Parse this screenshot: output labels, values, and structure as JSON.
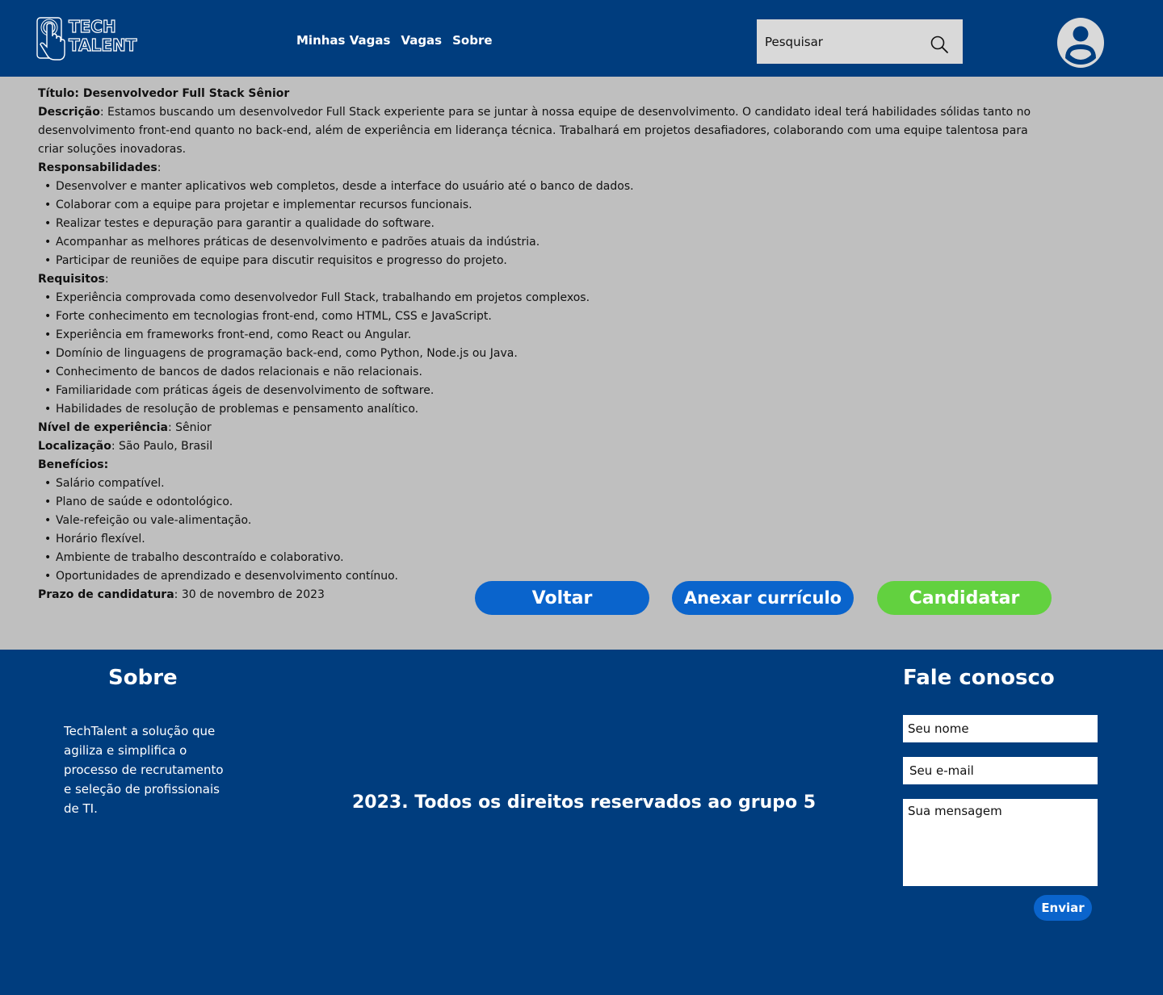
{
  "header": {
    "logo_text_line1": "TECH",
    "logo_text_line2": "TALENT",
    "nav": [
      {
        "label": "Minhas Vagas"
      },
      {
        "label": "Vagas"
      },
      {
        "label": "Sobre"
      }
    ],
    "search": {
      "placeholder": "Pesquisar",
      "icon": "search-icon"
    },
    "avatar_icon": "user-icon"
  },
  "job": {
    "title_label": "Título: Desenvolvedor Full Stack Sênior",
    "description_label": "Descrição",
    "description_text": ": Estamos buscando um desenvolvedor Full Stack experiente para se juntar à nossa equipe de desenvolvimento. O candidato ideal terá habilidades sólidas tanto no desenvolvimento front-end quanto no back-end, além de experiência em liderança técnica. Trabalhará em projetos desafiadores, colaborando com uma equipe talentosa para criar soluções inovadoras.",
    "responsibilities_label": "Responsabilidades",
    "responsibilities": [
      "Desenvolver e manter aplicativos web completos, desde a interface do usuário até o banco de dados.",
      "Colaborar com a equipe para projetar e implementar recursos funcionais.",
      "Realizar testes e depuração para garantir a qualidade do software.",
      "Acompanhar as melhores práticas de desenvolvimento e padrões atuais da indústria.",
      "Participar de reuniões de equipe para discutir requisitos e progresso do projeto."
    ],
    "requirements_label": "Requisitos",
    "requirements": [
      "Experiência comprovada como desenvolvedor Full Stack, trabalhando em projetos complexos.",
      "Forte conhecimento em tecnologias front-end, como HTML, CSS e JavaScript.",
      "Experiência em frameworks front-end, como React ou Angular.",
      "Domínio de linguagens de programação back-end, como Python, Node.js ou Java.",
      "Conhecimento de bancos de dados relacionais e não relacionais.",
      "Familiaridade com práticas ágeis de desenvolvimento de software.",
      "Habilidades de resolução de problemas e pensamento analítico."
    ],
    "level_label": "Nível de experiência",
    "level_value": ": Sênior",
    "location_label": "Localização",
    "location_value": ": São Paulo, Brasil",
    "benefits_label": "Benefícios:",
    "benefits": [
      "Salário compatível.",
      "Plano de saúde e odontológico.",
      "Vale-refeição ou vale-alimentação.",
      "Horário flexível.",
      "Ambiente de trabalho descontraído e colaborativo.",
      "Oportunidades de aprendizado e desenvolvimento contínuo."
    ],
    "deadline_label": "Prazo de candidatura",
    "deadline_value": ": 30 de novembro de 2023"
  },
  "actions": {
    "back": "Voltar",
    "attach": "Anexar currículo",
    "apply": "Candidatar"
  },
  "colors": {
    "primary": "#003d7e",
    "button_blue": "#0a64cc",
    "button_green": "#62d13f",
    "content_bg": "#bfbfbf"
  },
  "footer": {
    "about_title": "Sobre",
    "about_text": "TechTalent a solução que agiliza e simplifica o processo de recrutamento e seleção de profissionais de TI.",
    "copyright": "2023. Todos os direitos reservados ao grupo 5",
    "contact_title": "Fale conosco",
    "name_placeholder": "Seu nome",
    "email_placeholder": "Seu e-mail",
    "message_placeholder": "Sua mensagem",
    "send": "Enviar"
  }
}
